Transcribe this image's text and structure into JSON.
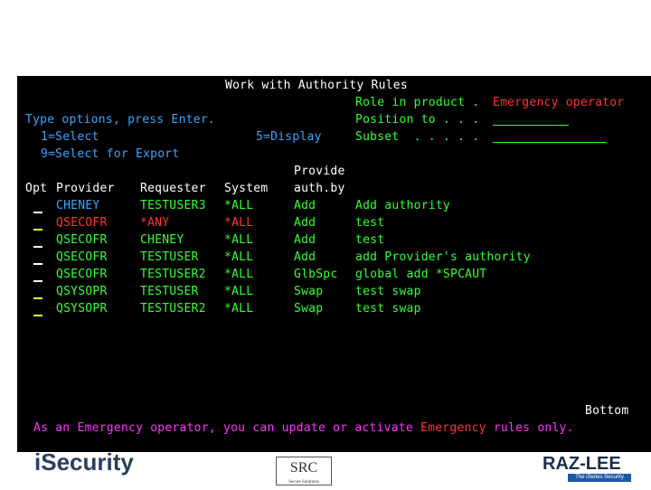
{
  "header": {
    "title": "Work with Authority Rules",
    "role_label": "Role in product .",
    "role_value": "Emergency operator",
    "position_label": "Position to . . .",
    "subset_label": "Subset  . . . . ."
  },
  "options": {
    "intro": "Type options, press Enter.",
    "opt1": "1=Select",
    "opt5": "5=Display",
    "opt9": "9=Select for Export"
  },
  "columns": {
    "opt": "Opt",
    "provider": "Provider",
    "requester": "Requester",
    "system": "System",
    "auth_line1": "Provide",
    "auth_line2": "auth.by",
    "description": ""
  },
  "rows": [
    {
      "provider": "CHENEY",
      "requester": "TESTUSER3",
      "system": "*ALL",
      "auth": "Add",
      "desc": "Add authority",
      "highlight": false
    },
    {
      "provider": "QSECOFR",
      "requester": "*ANY",
      "system": "*ALL",
      "auth": "Add",
      "desc": "test",
      "highlight": true
    },
    {
      "provider": "QSECOFR",
      "requester": "CHENEY",
      "system": "*ALL",
      "auth": "Add",
      "desc": "test",
      "highlight": false
    },
    {
      "provider": "QSECOFR",
      "requester": "TESTUSER",
      "system": "*ALL",
      "auth": "Add",
      "desc": "add Provider's authority",
      "highlight": false
    },
    {
      "provider": "QSECOFR",
      "requester": "TESTUSER2",
      "system": "*ALL",
      "auth": "GlbSpc",
      "desc": "global add *SPCAUT",
      "highlight": false
    },
    {
      "provider": "QSYSOPR",
      "requester": "TESTUSER",
      "system": "*ALL",
      "auth": "Swap",
      "desc": "test swap",
      "highlight": false
    },
    {
      "provider": "QSYSOPR",
      "requester": "TESTUSER2",
      "system": "*ALL",
      "auth": "Swap",
      "desc": "test swap",
      "highlight": false
    }
  ],
  "footer": {
    "bottom_label": "Bottom",
    "message_part1": "As an Emergency operator, you can update or activate ",
    "message_highlight": "Emergency",
    "message_part2": " rules only."
  },
  "logos": {
    "left": "iSecurity",
    "center": "SRC",
    "center_sub": "Secure Solutions",
    "right": "RAZ-LEE",
    "right_sub": "The iSeries Security Experts"
  },
  "colors": {
    "background": "#000000",
    "text_white": "#ffffff",
    "text_green": "#33ff33",
    "text_red": "#ff3333",
    "text_blue": "#3aa6ff",
    "text_pink": "#ff33ff"
  }
}
